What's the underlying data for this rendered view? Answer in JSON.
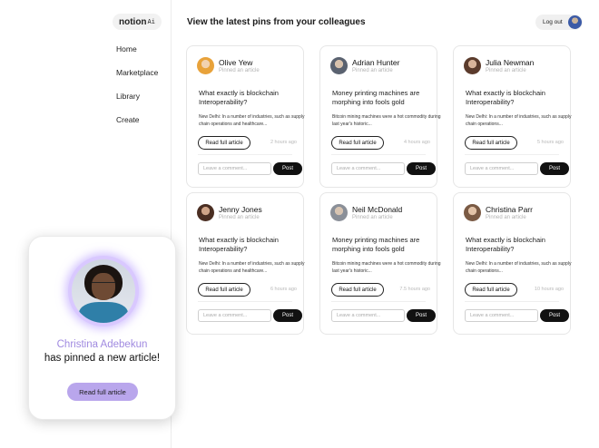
{
  "app": {
    "logo_text": "notion",
    "logo_suffix": "Ai"
  },
  "sidebar": {
    "items": [
      {
        "label": "Home"
      },
      {
        "label": "Marketplace"
      },
      {
        "label": "Library"
      },
      {
        "label": "Create"
      }
    ]
  },
  "header": {
    "title": "View the latest pins from your colleagues",
    "logout_label": "Log out"
  },
  "cards": [
    {
      "name": "Olive Yew",
      "action": "Pinned an article",
      "headline": "What exactly is blockchain Interoperability?",
      "excerpt": "New Delhi: In a number of industries, such as supply chain operations and healthcare...",
      "read_label": "Read full article",
      "time": "2 hours ago",
      "comment_placeholder": "Leave a comment...",
      "post_label": "Post",
      "avatar_colors": [
        "#e8a23a",
        "#f2d2b0"
      ]
    },
    {
      "name": "Adrian Hunter",
      "action": "Pinned an article",
      "headline": "Money printing machines are morphing into fools gold",
      "excerpt": "Bitcoin mining machines were a hot commodity during last year's historic...",
      "read_label": "Read full article",
      "time": "4 hours ago",
      "comment_placeholder": "Leave a comment...",
      "post_label": "Post",
      "avatar_colors": [
        "#5a6270",
        "#d8c2ad"
      ]
    },
    {
      "name": "Julia Newman",
      "action": "Pinned an article",
      "headline": "What exactly is blockchain Interoperability?",
      "excerpt": "New Delhi: In a number of industries, such as supply chain operations...",
      "read_label": "Read full article",
      "time": "5 hours ago",
      "comment_placeholder": "Leave a comment...",
      "post_label": "Post",
      "avatar_colors": [
        "#5b3b2c",
        "#d9b49a"
      ]
    },
    {
      "name": "Jenny Jones",
      "action": "Pinned an article",
      "headline": "What exactly is blockchain Interoperability?",
      "excerpt": "New Delhi: In a number of industries, such as supply chain operations and healthcare...",
      "read_label": "Read full article",
      "time": "6 hours ago",
      "comment_placeholder": "Leave a comment...",
      "post_label": "Post",
      "avatar_colors": [
        "#4a2e22",
        "#cfa488"
      ]
    },
    {
      "name": "Neil McDonald",
      "action": "Pinned an article",
      "headline": "Money printing machines are morphing into fools gold",
      "excerpt": "Bitcoin mining machines were a hot commodity during last year's historic...",
      "read_label": "Read full article",
      "time": "7.5 hours ago",
      "comment_placeholder": "Leave a comment...",
      "post_label": "Post",
      "avatar_colors": [
        "#8a8f98",
        "#d7c4b2"
      ]
    },
    {
      "name": "Christina Parr",
      "action": "Pinned an article",
      "headline": "What exactly is blockchain Interoperability?",
      "excerpt": "New Delhi: In a number of industries, such as supply chain operations...",
      "read_label": "Read full article",
      "time": "10 hours ago",
      "comment_placeholder": "Leave a comment...",
      "post_label": "Post",
      "avatar_colors": [
        "#7a5a44",
        "#e2c3a8"
      ]
    }
  ],
  "notification": {
    "person": "Christina Adebekun",
    "message": "has pinned a new article!",
    "cta_label": "Read full article",
    "accent": "#b9a6ec"
  }
}
